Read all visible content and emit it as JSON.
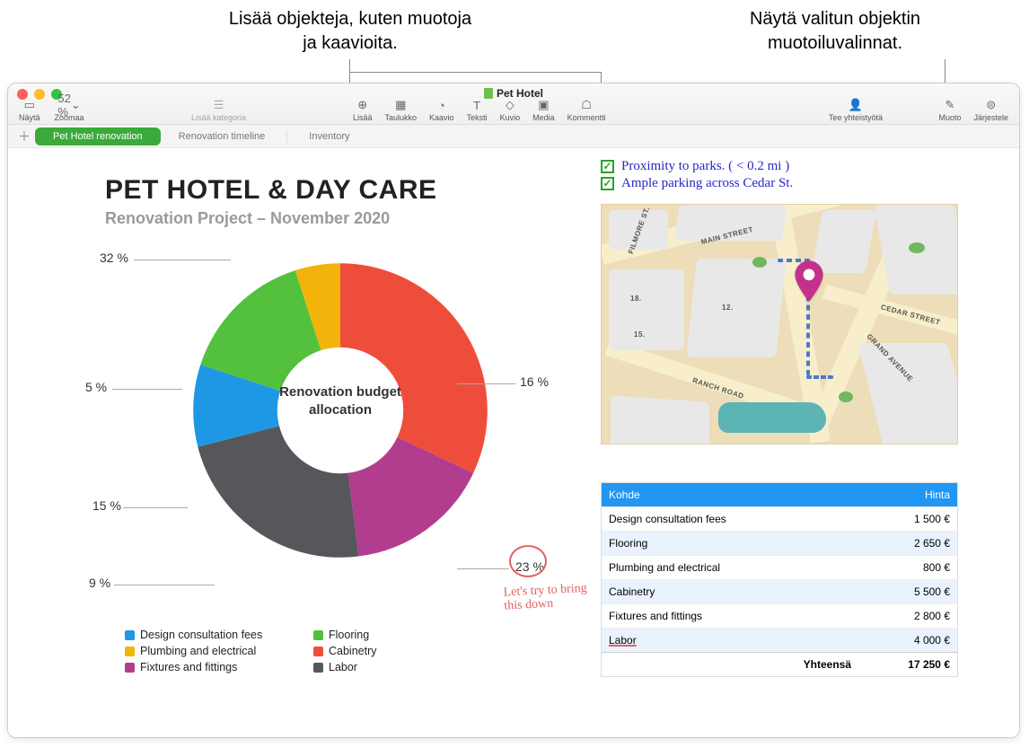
{
  "callouts": {
    "left": "Lisää objekteja, kuten muotoja ja kaavioita.",
    "right": "Näytä valitun objektin muotoiluvalinnat."
  },
  "window": {
    "doc_title": "Pet Hotel",
    "toolbar": {
      "nayta": "Näytä",
      "zoom_value": "52 %",
      "zoomaa": "Zoomaa",
      "lisaa_kategoria": "Lisää kategoria",
      "lisaa": "Lisää",
      "taulukko": "Taulukko",
      "kaavio": "Kaavio",
      "teksti": "Teksti",
      "kuvio": "Kuvio",
      "media": "Media",
      "kommentti": "Kommentti",
      "tee_yhteistyota": "Tee yhteistyötä",
      "muoto": "Muoto",
      "jarjestele": "Järjestele"
    },
    "tabs": {
      "t0": "Pet Hotel renovation",
      "t1": "Renovation timeline",
      "t2": "Inventory"
    }
  },
  "content": {
    "title": "PET HOTEL & DAY CARE",
    "subtitle": "Renovation Project – November 2020",
    "donut_center": "Renovation budget allocation",
    "slice_labels": {
      "p32": "32 %",
      "p16": "16 %",
      "p5": "5 %",
      "p15": "15 %",
      "p9": "9 %",
      "p23": "23 %"
    },
    "legend": {
      "l0": "Design consultation fees",
      "l1": "Flooring",
      "l2": "Plumbing and electrical",
      "l3": "Cabinetry",
      "l4": "Fixtures and fittings",
      "l5": "Labor"
    },
    "colors": {
      "design": "#1e98e4",
      "flooring": "#53c13d",
      "plumbing": "#f2b40a",
      "cabinetry": "#ef4d3c",
      "fixtures": "#b23d8e",
      "labor": "#55575a"
    },
    "handnote": "Let's try to bring this down"
  },
  "checks": {
    "c0": "Proximity to parks. ( < 0.2 mi )",
    "c1": "Ample parking across  Cedar St."
  },
  "map_labels": {
    "filmore": "FILMORE ST.",
    "main": "MAIN STREET",
    "ranch": "RANCH ROAD",
    "grand": "GRAND AVENUE",
    "cedar": "CEDAR STREET",
    "n18": "18.",
    "n15": "15.",
    "n12": "12."
  },
  "table": {
    "head_item": "Kohde",
    "head_price": "Hinta",
    "rows": [
      {
        "item": "Design consultation fees",
        "price": "1 500 €"
      },
      {
        "item": "Flooring",
        "price": "2 650 €"
      },
      {
        "item": "Plumbing and electrical",
        "price": "800 €"
      },
      {
        "item": "Cabinetry",
        "price": "5 500 €"
      },
      {
        "item": "Fixtures and fittings",
        "price": "2 800 €"
      },
      {
        "item": "Labor",
        "price": "4 000 €"
      }
    ],
    "total_label": "Yhteensä",
    "total_value": "17 250 €"
  },
  "chart_data": {
    "type": "pie",
    "title": "Renovation budget allocation",
    "series": [
      {
        "name": "Cabinetry",
        "value": 32,
        "color": "#ef4d3c"
      },
      {
        "name": "Fixtures and fittings",
        "value": 16,
        "color": "#b23d8e"
      },
      {
        "name": "Labor",
        "value": 23,
        "color": "#55575a"
      },
      {
        "name": "Design consultation fees",
        "value": 9,
        "color": "#1e98e4"
      },
      {
        "name": "Flooring",
        "value": 15,
        "color": "#53c13d"
      },
      {
        "name": "Plumbing and electrical",
        "value": 5,
        "color": "#f2b40a"
      }
    ]
  }
}
